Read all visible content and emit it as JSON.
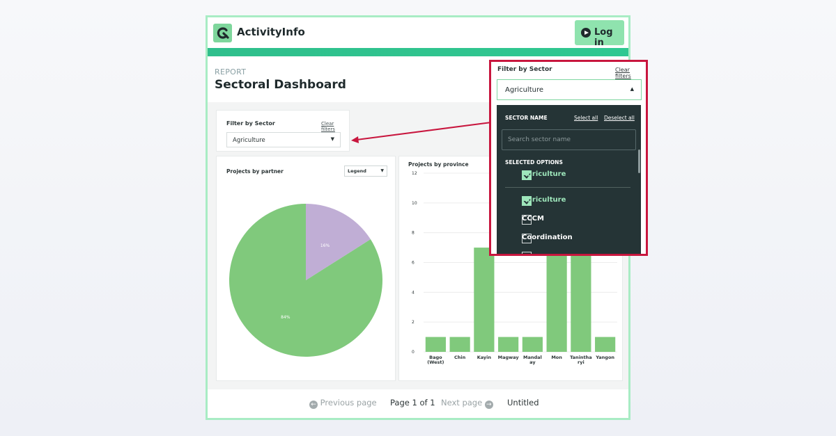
{
  "app": {
    "name": "ActivityInfo",
    "login_label": "Log in"
  },
  "header": {
    "eyebrow": "REPORT",
    "title": "Sectoral Dashboard"
  },
  "filter": {
    "label": "Filter by Sector",
    "clear": "Clear filters",
    "value": "Agriculture"
  },
  "pie_card": {
    "title": "Projects by partner",
    "legend_label": "Legend"
  },
  "bar_card": {
    "title": "Projects by province"
  },
  "chart_data": [
    {
      "type": "pie",
      "title": "Projects by partner",
      "slices": [
        {
          "label": "84%",
          "value": 84,
          "color": "#80c97c"
        },
        {
          "label": "16%",
          "value": 16,
          "color": "#c0aed5"
        }
      ]
    },
    {
      "type": "bar",
      "title": "Projects by province",
      "categories": [
        "Bago (West)",
        "Chin",
        "Kayin",
        "Magway",
        "Mandalay",
        "Mon",
        "Tanintharyi",
        "Yangon"
      ],
      "category_lines": [
        [
          "Bago",
          "(West)"
        ],
        [
          "Chin"
        ],
        [
          "Kayin"
        ],
        [
          "Magway"
        ],
        [
          "Mandal",
          "ay"
        ],
        [
          "Mon"
        ],
        [
          "Tanintha",
          "ryi"
        ],
        [
          "Yangon"
        ]
      ],
      "values": [
        1,
        1,
        7,
        1,
        1,
        7,
        7,
        1
      ],
      "ylim": [
        0,
        12
      ],
      "yticks": [
        0,
        2,
        4,
        6,
        8,
        10,
        12
      ],
      "color": "#80c97c",
      "grid": true
    }
  ],
  "pager": {
    "prev": "Previous page",
    "page": "Page 1 of 1",
    "next": "Next page",
    "title": "Untitled"
  },
  "dropdown": {
    "column_title": "SECTOR NAME",
    "select_all": "Select all",
    "deselect_all": "Deselect all",
    "search_placeholder": "Search sector name",
    "selected_group_title": "SELECTED OPTIONS",
    "selected": [
      {
        "label": "Agriculture",
        "checked": true
      }
    ],
    "options": [
      {
        "label": "Agriculture",
        "checked": true
      },
      {
        "label": "CCCM",
        "checked": false
      },
      {
        "label": "Coordination",
        "checked": false
      }
    ]
  },
  "colors": {
    "accent": "#2fbf8c",
    "frame": "#a8ecc4",
    "highlight": "#c8163e",
    "dropdown_bg": "#253436",
    "chart_green": "#80c97c",
    "chart_purple": "#c0aed5"
  }
}
